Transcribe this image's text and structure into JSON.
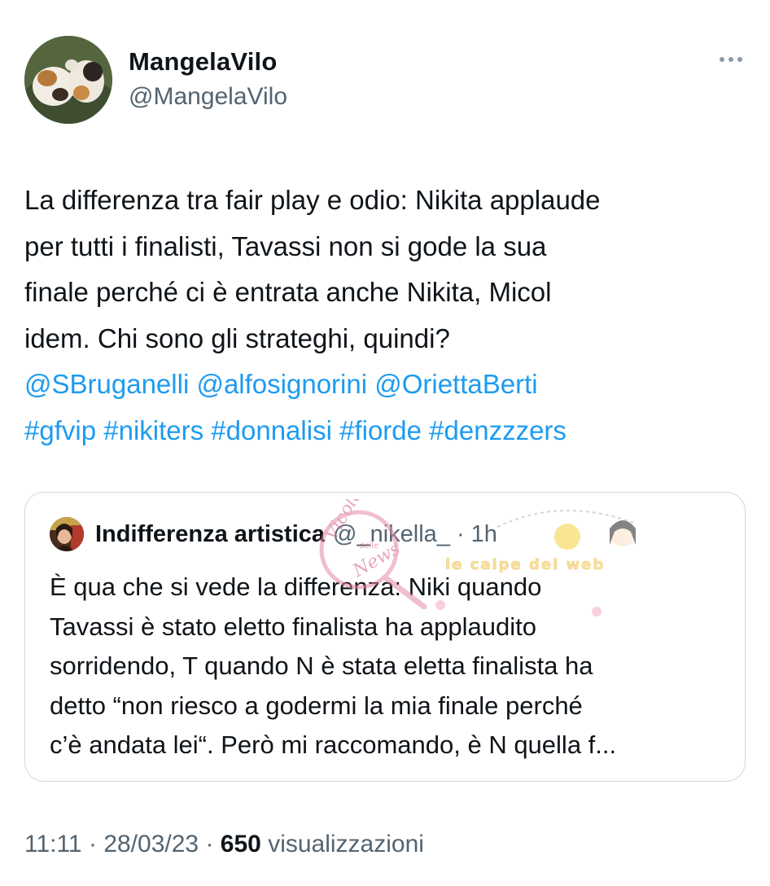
{
  "author": {
    "display_name": "MangelaVilo",
    "handle": "@MangelaVilo",
    "avatar_icon": "cats-photo-avatar"
  },
  "tweet": {
    "lines": [
      "La differenza tra fair play e odio: Nikita applaude",
      "per tutti i finalisti, Tavassi non si gode la sua",
      "finale perché ci è entrata anche Nikita, Micol",
      "idem. Chi sono gli strateghi, quindi?"
    ],
    "mentions": [
      "@SBruganelli",
      "@alfosignorini",
      "@OriettaBerti"
    ],
    "hashtags": [
      "#gfvip",
      "#nikiters",
      "#donnalisi",
      "#fiorde",
      "#denzzzers"
    ]
  },
  "quoted": {
    "display_name": "Indifferenza artistica",
    "handle": "@_nikella_",
    "separator": "·",
    "time": "1h",
    "lines": [
      "È qua che si vede la differenza: Niki quando",
      "Tavassi è stato eletto finalista ha applaudito",
      "sorridendo, T quando N è stata eletta finalista ha",
      "detto “non riesco a godermi la mia finale perché",
      "c’è andata lei“. Però mi raccomando, è N quella f..."
    ],
    "watermark": {
      "left": "Vicolo",
      "small": "delle",
      "bottom": "News",
      "right": "le caipe del web"
    }
  },
  "meta": {
    "time": "11:11",
    "sep1": "·",
    "date": "28/03/23",
    "sep2": "·",
    "views_count": "650",
    "views_label": "visualizzazioni"
  },
  "colors": {
    "link": "#1d9bf0",
    "text": "#0f1419",
    "secondary": "#536471",
    "border": "#cfd9de"
  }
}
